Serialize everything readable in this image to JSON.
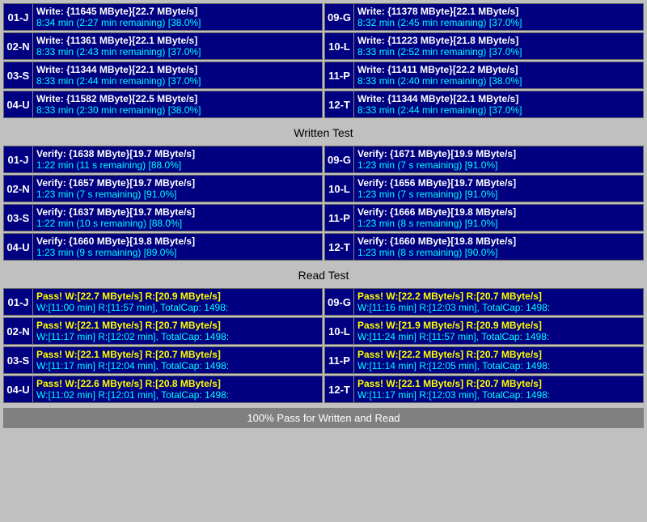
{
  "sections": {
    "write_test": {
      "label": "Written Test",
      "rows_left": [
        {
          "id": "01-J",
          "line1": "Write: {11645 MByte}[22.7 MByte/s]",
          "line2": "8:34 min (2:27 min remaining)  [38.0%]"
        },
        {
          "id": "02-N",
          "line1": "Write: {11361 MByte}[22.1 MByte/s]",
          "line2": "8:33 min (2:43 min remaining)  [37.0%]"
        },
        {
          "id": "03-S",
          "line1": "Write: {11344 MByte}[22.1 MByte/s]",
          "line2": "8:33 min (2:44 min remaining)  [37.0%]"
        },
        {
          "id": "04-U",
          "line1": "Write: {11582 MByte}[22.5 MByte/s]",
          "line2": "8:33 min (2:30 min remaining)  [38.0%]"
        }
      ],
      "rows_right": [
        {
          "id": "09-G",
          "line1": "Write: {11378 MByte}[22.1 MByte/s]",
          "line2": "8:32 min (2:45 min remaining)  [37.0%]"
        },
        {
          "id": "10-L",
          "line1": "Write: {11223 MByte}[21.8 MByte/s]",
          "line2": "8:33 min (2:52 min remaining)  [37.0%]"
        },
        {
          "id": "11-P",
          "line1": "Write: {11411 MByte}[22.2 MByte/s]",
          "line2": "8:33 min (2:40 min remaining)  [38.0%]"
        },
        {
          "id": "12-T",
          "line1": "Write: {11344 MByte}[22.1 MByte/s]",
          "line2": "8:33 min (2:44 min remaining)  [37.0%]"
        }
      ]
    },
    "verify_test": {
      "rows_left": [
        {
          "id": "01-J",
          "line1": "Verify: {1638 MByte}[19.7 MByte/s]",
          "line2": "1:22 min (11 s remaining)   [88.0%]"
        },
        {
          "id": "02-N",
          "line1": "Verify: {1657 MByte}[19.7 MByte/s]",
          "line2": "1:23 min (7 s remaining)   [91.0%]"
        },
        {
          "id": "03-S",
          "line1": "Verify: {1637 MByte}[19.7 MByte/s]",
          "line2": "1:22 min (10 s remaining)   [88.0%]"
        },
        {
          "id": "04-U",
          "line1": "Verify: {1660 MByte}[19.8 MByte/s]",
          "line2": "1:23 min (9 s remaining)   [89.0%]"
        }
      ],
      "rows_right": [
        {
          "id": "09-G",
          "line1": "Verify: {1671 MByte}[19.9 MByte/s]",
          "line2": "1:23 min (7 s remaining)   [91.0%]"
        },
        {
          "id": "10-L",
          "line1": "Verify: {1656 MByte}[19.7 MByte/s]",
          "line2": "1:23 min (7 s remaining)   [91.0%]"
        },
        {
          "id": "11-P",
          "line1": "Verify: {1666 MByte}[19.8 MByte/s]",
          "line2": "1:23 min (8 s remaining)   [91.0%]"
        },
        {
          "id": "12-T",
          "line1": "Verify: {1660 MByte}[19.8 MByte/s]",
          "line2": "1:23 min (8 s remaining)   [90.0%]"
        }
      ]
    },
    "read_test": {
      "label": "Read Test",
      "rows_left": [
        {
          "id": "01-J",
          "line1": "Pass! W:[22.7 MByte/s] R:[20.9 MByte/s]",
          "line2": "W:[11:00 min] R:[11:57 min], TotalCap: 1498:"
        },
        {
          "id": "02-N",
          "line1": "Pass! W:[22.1 MByte/s] R:[20.7 MByte/s]",
          "line2": "W:[11:17 min] R:[12:02 min], TotalCap: 1498:"
        },
        {
          "id": "03-S",
          "line1": "Pass! W:[22.1 MByte/s] R:[20.7 MByte/s]",
          "line2": "W:[11:17 min] R:[12:04 min], TotalCap: 1498:"
        },
        {
          "id": "04-U",
          "line1": "Pass! W:[22.6 MByte/s] R:[20.8 MByte/s]",
          "line2": "W:[11:02 min] R:[12:01 min], TotalCap: 1498:"
        }
      ],
      "rows_right": [
        {
          "id": "09-G",
          "line1": "Pass! W:[22.2 MByte/s] R:[20.7 MByte/s]",
          "line2": "W:[11:16 min] R:[12:03 min], TotalCap: 1498:"
        },
        {
          "id": "10-L",
          "line1": "Pass! W:[21.9 MByte/s] R:[20.9 MByte/s]",
          "line2": "W:[11:24 min] R:[11:57 min], TotalCap: 1498:"
        },
        {
          "id": "11-P",
          "line1": "Pass! W:[22.2 MByte/s] R:[20.7 MByte/s]",
          "line2": "W:[11:14 min] R:[12:05 min], TotalCap: 1498:"
        },
        {
          "id": "12-T",
          "line1": "Pass! W:[22.1 MByte/s] R:[20.7 MByte/s]",
          "line2": "W:[11:17 min] R:[12:03 min], TotalCap: 1498:"
        }
      ]
    }
  },
  "footer": {
    "label": "100% Pass for Written and Read"
  },
  "written_test_header": "Written Test",
  "read_test_header": "Read Test"
}
